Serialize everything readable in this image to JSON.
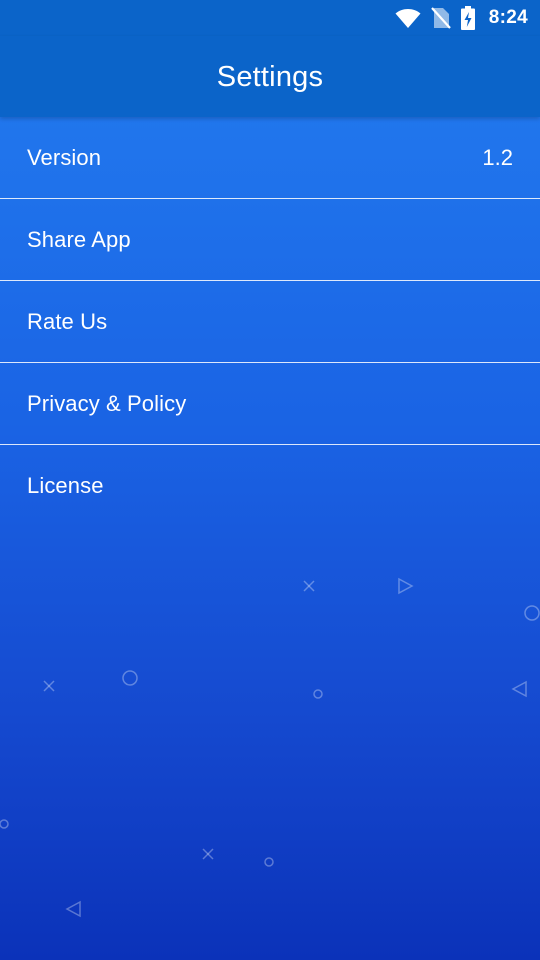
{
  "status_bar": {
    "time": "8:24",
    "icons": [
      "wifi-icon",
      "no-sim-icon",
      "battery-charging-icon"
    ]
  },
  "app_bar": {
    "title": "Settings"
  },
  "settings": {
    "items": [
      {
        "label": "Version",
        "value": "1.2"
      },
      {
        "label": "Share App"
      },
      {
        "label": "Rate Us"
      },
      {
        "label": "Privacy & Policy"
      },
      {
        "label": "License"
      }
    ]
  },
  "colors": {
    "app_bar": "#0b64c9",
    "background_top": "#237df0",
    "background_bottom": "#0b32b9",
    "text": "#ffffff"
  }
}
